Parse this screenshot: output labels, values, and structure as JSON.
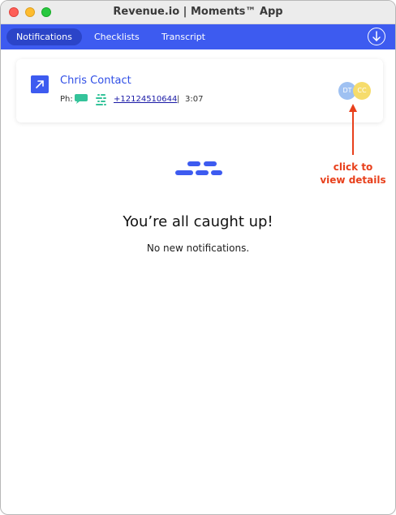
{
  "window": {
    "title": "Revenue.io | Moments™ App"
  },
  "nav": {
    "tabs": [
      {
        "label": "Notifications",
        "active": true
      },
      {
        "label": "Checklists",
        "active": false
      },
      {
        "label": "Transcript",
        "active": false
      }
    ],
    "download_icon": "download-circle-icon"
  },
  "card": {
    "contact_name": "Chris Contact",
    "ph_label": "Ph:",
    "phone": "+12124510644",
    "separator": "|",
    "duration": "3:07",
    "avatars": [
      {
        "initials": "DT",
        "color": "#9fc1f2"
      },
      {
        "initials": "CC",
        "color": "#f6dc6c"
      }
    ]
  },
  "empty_state": {
    "title": "You’re all caught up!",
    "subtitle": "No new notifications."
  },
  "annotation": {
    "text_line1": "click to",
    "text_line2": "view details"
  },
  "colors": {
    "accent": "#3d5bf0",
    "annotation": "#e8401c",
    "sms": "#34c39a"
  }
}
